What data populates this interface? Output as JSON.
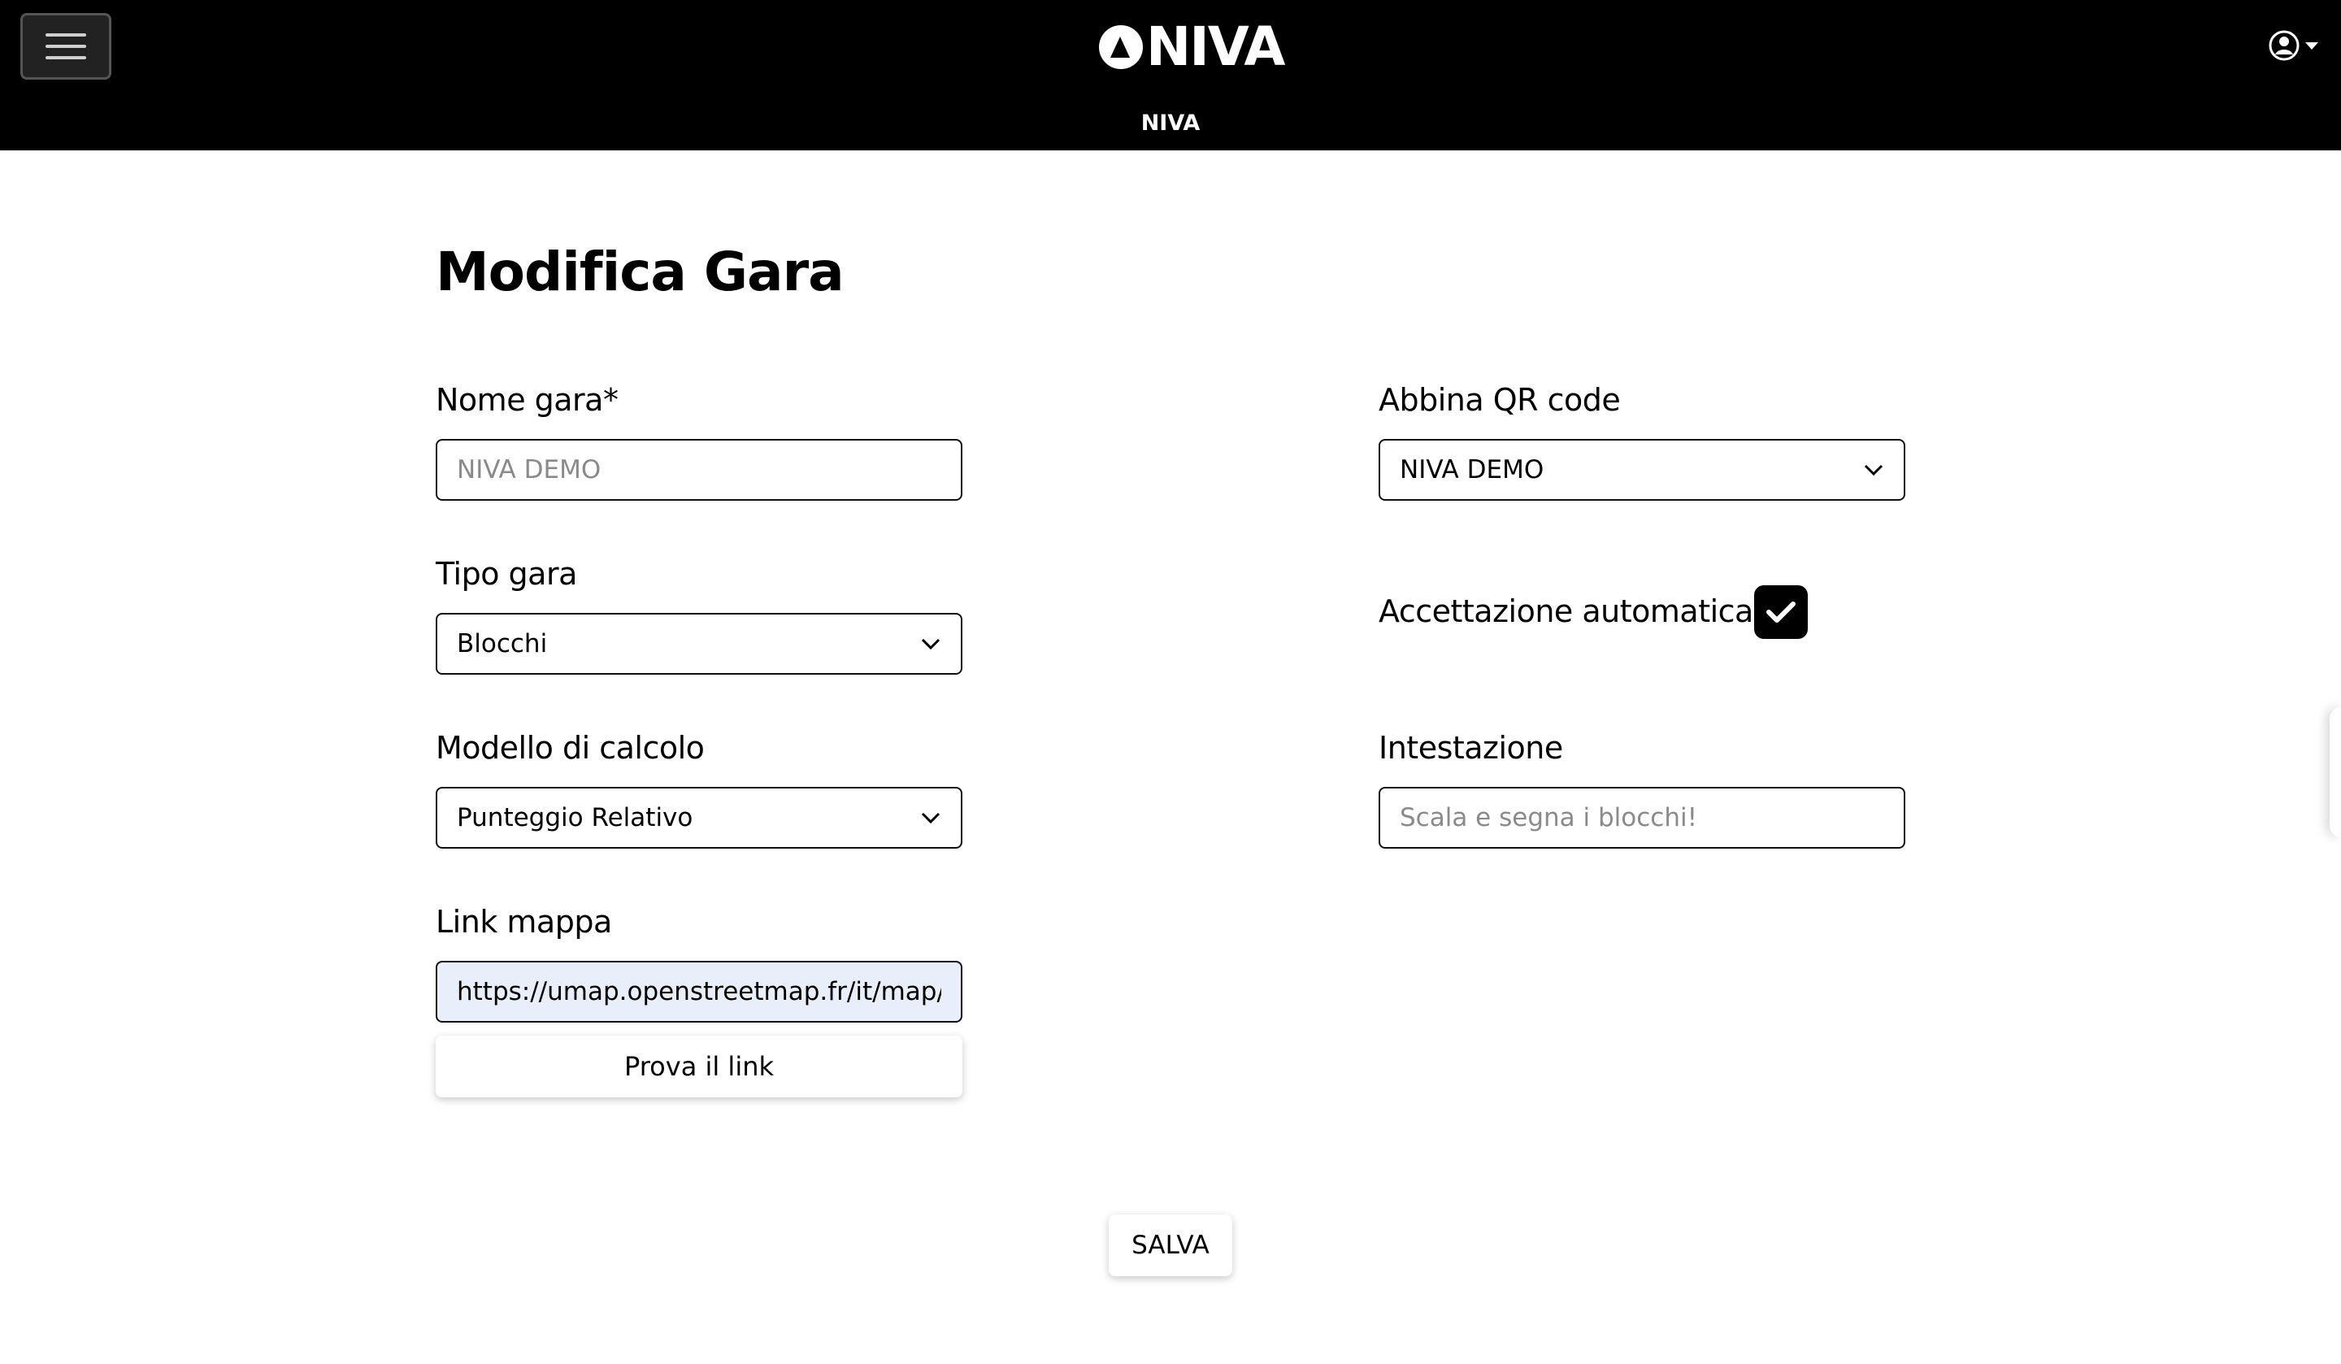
{
  "header": {
    "logo_text": "NIVA",
    "brand_label": "NIVA",
    "menu_icon": "hamburger-icon",
    "user_icon": "user-circle-icon",
    "background": "#000000"
  },
  "page": {
    "title": "Modifica Gara"
  },
  "form": {
    "nome_gara": {
      "label": "Nome gara*",
      "placeholder": "NIVA DEMO",
      "value": ""
    },
    "abbina_qr": {
      "label": "Abbina QR code",
      "selected": "NIVA DEMO"
    },
    "tipo_gara": {
      "label": "Tipo gara",
      "selected": "Blocchi"
    },
    "accettazione": {
      "label": "Accettazione automatica",
      "checked": true
    },
    "modello_calcolo": {
      "label": "Modello di calcolo",
      "selected": "Punteggio Relativo"
    },
    "intestazione": {
      "label": "Intestazione",
      "placeholder": "Scala e segna i blocchi!",
      "value": ""
    },
    "link_mappa": {
      "label": "Link mappa",
      "value": "https://umap.openstreetmap.fr/it/map/niva"
    },
    "prova_link_label": "Prova il link",
    "save_label": "SALVA"
  }
}
